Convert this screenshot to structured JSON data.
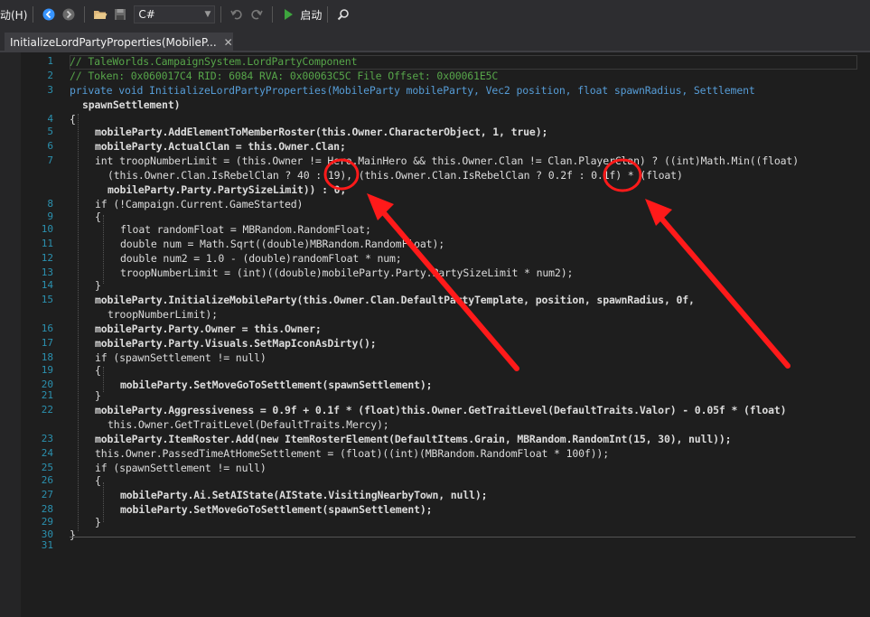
{
  "toolbar": {
    "menu_label": "动(H)",
    "language": "C#",
    "start_label": "启动"
  },
  "tab": {
    "title": "InitializeLordPartyProperties(MobileP...",
    "close": "✕"
  },
  "colors": {
    "background": "#1e1e1e",
    "comment": "#57a64a",
    "keyword": "#569cd6",
    "type": "#4ec9b0",
    "method": "#ff8000",
    "annotation": "#ff0000"
  },
  "line_numbers": [
    "1",
    "2",
    "3",
    "4",
    "5",
    "6",
    "7",
    "8",
    "9",
    "10",
    "11",
    "12",
    "13",
    "14",
    "15",
    "16",
    "17",
    "18",
    "19",
    "20",
    "21",
    "22",
    "23",
    "24",
    "25",
    "26",
    "27",
    "28",
    "29",
    "30",
    "31"
  ],
  "code_text": [
    "// TaleWorlds.CampaignSystem.LordPartyComponent",
    "// Token: 0x060017C4 RID: 6084 RVA: 0x00063C5C File Offset: 0x00061E5C",
    "private void InitializeLordPartyProperties(MobileParty mobileParty, Vec2 position, float spawnRadius, Settlement",
    "spawnSettlement)",
    "{",
    "mobileParty.AddElementToMemberRoster(this.Owner.CharacterObject, 1, true);",
    "mobileParty.ActualClan = this.Owner.Clan;",
    "int troopNumberLimit = (this.Owner != Hero.MainHero && this.Owner.Clan != Clan.PlayerClan) ? ((int)Math.Min((float)",
    "(this.Owner.Clan.IsRebelClan ? 40 : 19), (this.Owner.Clan.IsRebelClan ? 0.2f : 0.1f) * (float)",
    "mobileParty.Party.PartySizeLimit)) : 0;",
    "if (!Campaign.Current.GameStarted)",
    "{",
    "float randomFloat = MBRandom.RandomFloat;",
    "double num = Math.Sqrt((double)MBRandom.RandomFloat);",
    "double num2 = 1.0 - (double)randomFloat * num;",
    "troopNumberLimit = (int)((double)mobileParty.Party.PartySizeLimit * num2);",
    "}",
    "mobileParty.InitializeMobileParty(this.Owner.Clan.DefaultPartyTemplate, position, spawnRadius, 0f,",
    "troopNumberLimit);",
    "mobileParty.Party.Owner = this.Owner;",
    "mobileParty.Party.Visuals.SetMapIconAsDirty();",
    "if (spawnSettlement != null)",
    "{",
    "mobileParty.SetMoveGoToSettlement(spawnSettlement);",
    "}",
    "mobileParty.Aggressiveness = 0.9f + 0.1f * (float)this.Owner.GetTraitLevel(DefaultTraits.Valor) - 0.05f * (float)",
    "this.Owner.GetTraitLevel(DefaultTraits.Mercy);",
    "mobileParty.ItemRoster.Add(new ItemRosterElement(DefaultItems.Grain, MBRandom.RandomInt(15, 30), null));",
    "this.Owner.PassedTimeAtHomeSettlement = (float)((int)(MBRandom.RandomFloat * 100f));",
    "if (spawnSettlement != null)",
    "{",
    "mobileParty.Ai.SetAIState(AIState.VisitingNearbyTown, null);",
    "mobileParty.SetMoveGoToSettlement(spawnSettlement);",
    "}",
    "}"
  ]
}
